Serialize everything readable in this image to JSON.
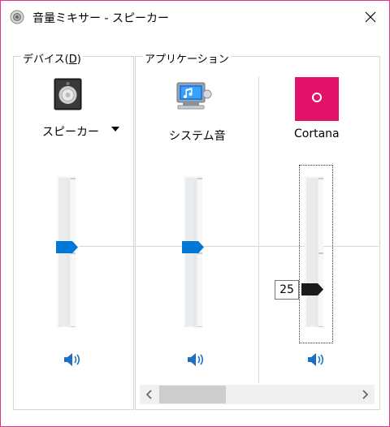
{
  "window": {
    "title": "音量ミキサー - スピーカー"
  },
  "device_group": {
    "label": "デバイス(",
    "accel": "D",
    "label_end": ")",
    "device_name": "スピーカー",
    "volume_percent": 50
  },
  "apps_group": {
    "label": "アプリケーション",
    "apps": [
      {
        "name": "システム音",
        "volume_percent": 50,
        "icon": "system-sounds-icon"
      },
      {
        "name": "Cortana",
        "volume_percent": 25,
        "icon": "cortana-icon",
        "tooltip": "25"
      }
    ]
  },
  "colors": {
    "accent": "#0078d7",
    "cortana": "#e3126b",
    "window_border": "#e1338a"
  }
}
